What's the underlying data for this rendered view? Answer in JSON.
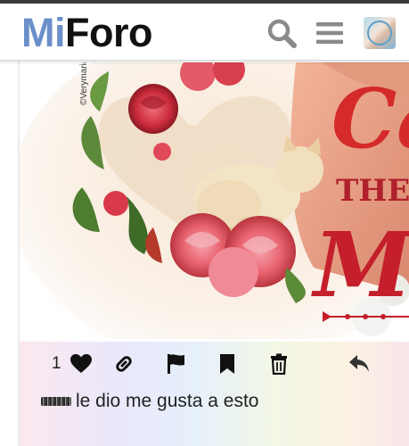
{
  "header": {
    "logo_part1": "Mi",
    "logo_part2": "Foro"
  },
  "post": {
    "image_text": {
      "watermark": "©Verymaria",
      "title_part": "Ca",
      "subtitle_part": "THE F",
      "bottom_part": "Mo"
    }
  },
  "actions": {
    "like_count": "1"
  },
  "liked_by": {
    "text": "le dio me gusta a esto"
  },
  "colors": {
    "logo_mi": "#6b8fc9",
    "logo_foro": "#111111",
    "icon_gray": "#8a8a8a",
    "title_red": "#d42a2a"
  }
}
